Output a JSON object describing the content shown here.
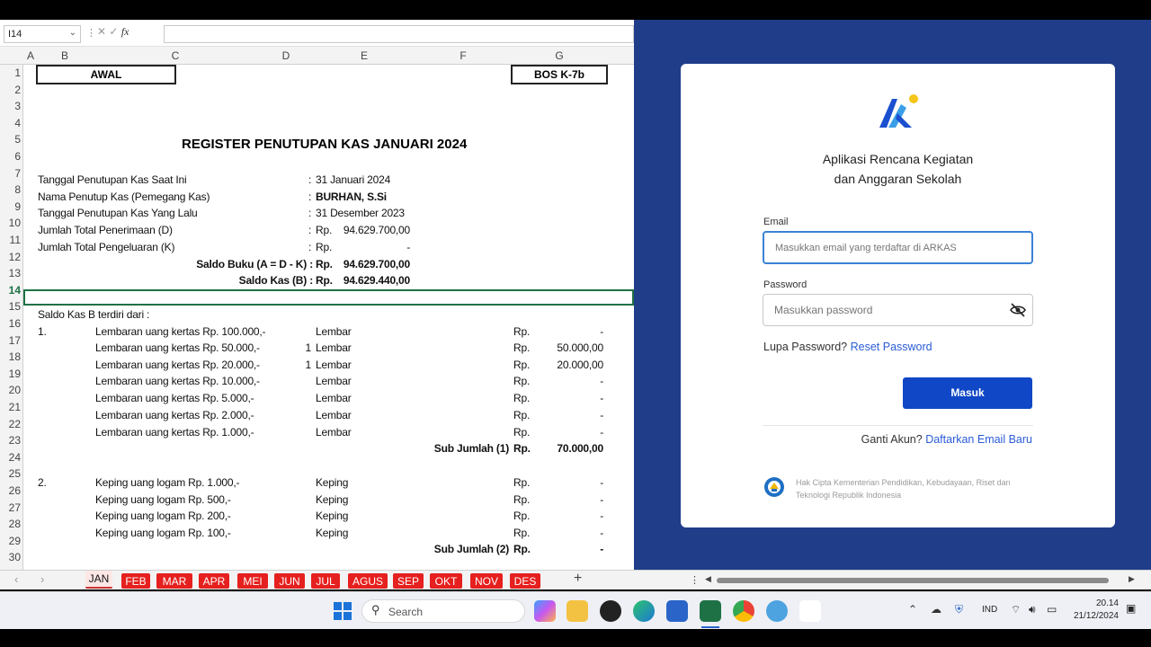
{
  "excel": {
    "namebox": "I14",
    "fx": "fx",
    "columns": [
      "A",
      "B",
      "C",
      "D",
      "E",
      "F",
      "G"
    ],
    "rows": [
      "1",
      "2",
      "3",
      "4",
      "5",
      "6",
      "7",
      "8",
      "9",
      "10",
      "11",
      "12",
      "13",
      "14",
      "15",
      "16",
      "17",
      "18",
      "19",
      "20",
      "21",
      "22",
      "23",
      "24",
      "25",
      "26",
      "27",
      "28",
      "29",
      "30"
    ],
    "box_left": "AWAL",
    "box_right": "BOS K-7b",
    "title": "REGISTER PENUTUPAN KAS JANUARI 2024",
    "r7_label": "Tanggal Penutupan Kas Saat Ini",
    "r7_value": "31 Januari 2024",
    "r8_label": "Nama Penutup Kas (Pemegang Kas)",
    "r8_value": "BURHAN, S.Si",
    "r9_label": "Tanggal Penutupan Kas Yang Lalu",
    "r9_value": "31 Desember 2023",
    "r10_label": "Jumlah Total Penerimaan (D)",
    "r10_rp": "Rp.",
    "r10_value": "94.629.700,00",
    "r11_label": "Jumlah Total Pengeluaran (K)",
    "r11_rp": "Rp.",
    "r11_value": "-",
    "r12_label": "Saldo Buku (A = D - K) :",
    "r12_rp": "Rp.",
    "r12_value": "94.629.700,00",
    "r13_label": "Saldo Kas (B) :",
    "r13_rp": "Rp.",
    "r13_value": "94.629.440,00",
    "colon": ":",
    "r15": "Saldo Kas B terdiri dari :",
    "sec1": "1.",
    "sec2": "2.",
    "kertas": [
      {
        "label": "Lembaran uang kertas Rp. 100.000,-",
        "qty": "",
        "unit": "Lembar",
        "rp": "Rp.",
        "val": "-"
      },
      {
        "label": "Lembaran uang kertas Rp. 50.000,-",
        "qty": "1",
        "unit": "Lembar",
        "rp": "Rp.",
        "val": "50.000,00"
      },
      {
        "label": "Lembaran uang kertas Rp. 20.000,-",
        "qty": "1",
        "unit": "Lembar",
        "rp": "Rp.",
        "val": "20.000,00"
      },
      {
        "label": "Lembaran uang kertas Rp. 10.000,-",
        "qty": "",
        "unit": "Lembar",
        "rp": "Rp.",
        "val": "-"
      },
      {
        "label": "Lembaran uang kertas Rp. 5.000,-",
        "qty": "",
        "unit": "Lembar",
        "rp": "Rp.",
        "val": "-"
      },
      {
        "label": "Lembaran uang kertas Rp. 2.000,-",
        "qty": "",
        "unit": "Lembar",
        "rp": "Rp.",
        "val": "-"
      },
      {
        "label": "Lembaran uang kertas Rp. 1.000,-",
        "qty": "",
        "unit": "Lembar",
        "rp": "Rp.",
        "val": "-"
      }
    ],
    "sub1_label": "Sub Jumlah (1)",
    "sub1_rp": "Rp.",
    "sub1_val": "70.000,00",
    "logam": [
      {
        "label": "Keping uang logam Rp. 1.000,-",
        "unit": "Keping",
        "rp": "Rp.",
        "val": "-"
      },
      {
        "label": "Keping uang logam Rp. 500,-",
        "unit": "Keping",
        "rp": "Rp.",
        "val": "-"
      },
      {
        "label": "Keping uang logam Rp. 200,-",
        "unit": "Keping",
        "rp": "Rp.",
        "val": "-"
      },
      {
        "label": "Keping uang logam Rp. 100,-",
        "unit": "Keping",
        "rp": "Rp.",
        "val": "-"
      }
    ],
    "sub2_label": "Sub Jumlah (2)",
    "sub2_rp": "Rp.",
    "sub2_val": "-",
    "tabs": [
      "JAN",
      "FEB",
      "MAR",
      "APR",
      "MEI",
      "JUN",
      "JUL",
      "AGUS",
      "SEP",
      "OKT",
      "NOV",
      "DES"
    ],
    "add_sheet": "+"
  },
  "login": {
    "app_title_1": "Aplikasi Rencana Kegiatan",
    "app_title_2": "dan Anggaran Sekolah",
    "email_label": "Email",
    "email_placeholder": "Masukkan email yang terdaftar di ARKAS",
    "password_label": "Password",
    "password_placeholder": "Masukkan password",
    "forgot_text": "Lupa Password?",
    "reset_link": "Reset Password",
    "submit": "Masuk",
    "change_text": "Ganti Akun?",
    "register_link": "Daftarkan Email Baru",
    "copyright": "Hak Cipta Kementerian Pendidikan, Kebudayaan, Riset dan Teknologi Republik Indonesia",
    "accent": "#0f47c6"
  },
  "taskbar": {
    "search": "Search",
    "lang": "IND",
    "time": "20.14",
    "date": "21/12/2024"
  }
}
